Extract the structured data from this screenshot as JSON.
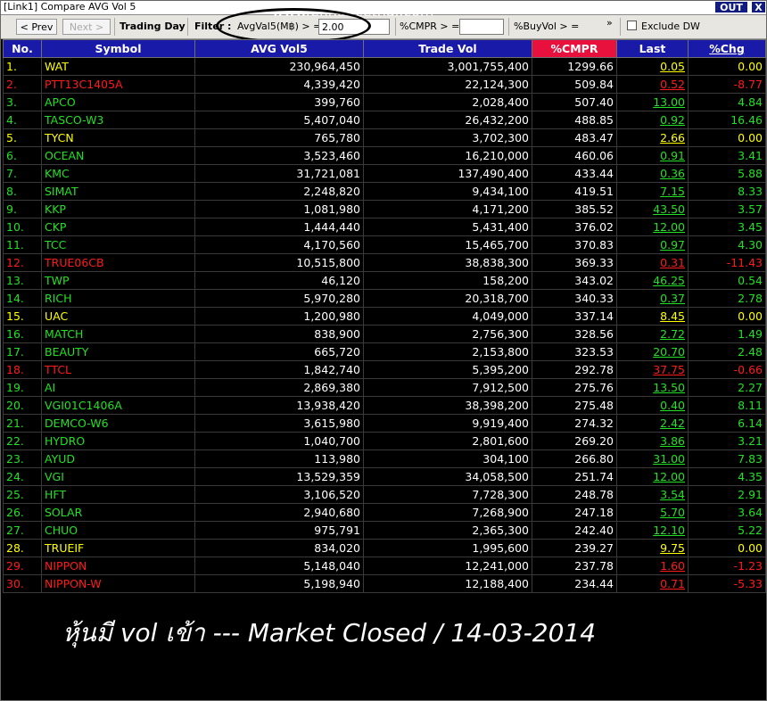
{
  "window": {
    "title": "[Link1] Compare AVG Vol 5",
    "out_label": "OUT",
    "close_label": "X"
  },
  "toolbar": {
    "prev_label": "< Prev",
    "next_label": "Next >",
    "trading_day_label": "Trading Day",
    "filter_label": "Filter :",
    "avgval_label": "AvgVal5(M฿) > =",
    "avgval_value": "2.00",
    "cmpr_label": "%CMPR > =",
    "cmpr_value": "",
    "buyvol_label": "%BuyVol > =",
    "more_label": "»",
    "exclude_dw_label": "Exclude DW",
    "exclude_dw_checked": false
  },
  "watermark": "www.efinancethai.com",
  "table": {
    "headers": {
      "no": "No.",
      "symbol": "Symbol",
      "avg_vol": "AVG Vol5",
      "trade_vol": "Trade Vol",
      "cmpr": "%CMPR",
      "last": "Last",
      "chg": "%Chg"
    },
    "rows": [
      {
        "no": "1.",
        "symbol": "WAT",
        "avg": "230,964,450",
        "trade": "3,001,755,400",
        "cmpr": "1299.66",
        "last": "0.05",
        "chg": "0.00",
        "color": "yellow"
      },
      {
        "no": "2.",
        "symbol": "PTT13C1405A",
        "avg": "4,339,420",
        "trade": "22,124,300",
        "cmpr": "509.84",
        "last": "0.52",
        "chg": "-8.77",
        "color": "red"
      },
      {
        "no": "3.",
        "symbol": "APCO",
        "avg": "399,760",
        "trade": "2,028,400",
        "cmpr": "507.40",
        "last": "13.00",
        "chg": "4.84",
        "color": "green"
      },
      {
        "no": "4.",
        "symbol": "TASCO-W3",
        "avg": "5,407,040",
        "trade": "26,432,200",
        "cmpr": "488.85",
        "last": "0.92",
        "chg": "16.46",
        "color": "green"
      },
      {
        "no": "5.",
        "symbol": "TYCN",
        "avg": "765,780",
        "trade": "3,702,300",
        "cmpr": "483.47",
        "last": "2.66",
        "chg": "0.00",
        "color": "yellow"
      },
      {
        "no": "6.",
        "symbol": "OCEAN",
        "avg": "3,523,460",
        "trade": "16,210,000",
        "cmpr": "460.06",
        "last": "0.91",
        "chg": "3.41",
        "color": "green"
      },
      {
        "no": "7.",
        "symbol": "KMC",
        "avg": "31,721,081",
        "trade": "137,490,400",
        "cmpr": "433.44",
        "last": "0.36",
        "chg": "5.88",
        "color": "green"
      },
      {
        "no": "8.",
        "symbol": "SIMAT",
        "avg": "2,248,820",
        "trade": "9,434,100",
        "cmpr": "419.51",
        "last": "7.15",
        "chg": "8.33",
        "color": "green"
      },
      {
        "no": "9.",
        "symbol": "KKP",
        "avg": "1,081,980",
        "trade": "4,171,200",
        "cmpr": "385.52",
        "last": "43.50",
        "chg": "3.57",
        "color": "green"
      },
      {
        "no": "10.",
        "symbol": "CKP",
        "avg": "1,444,440",
        "trade": "5,431,400",
        "cmpr": "376.02",
        "last": "12.00",
        "chg": "3.45",
        "color": "green"
      },
      {
        "no": "11.",
        "symbol": "TCC",
        "avg": "4,170,560",
        "trade": "15,465,700",
        "cmpr": "370.83",
        "last": "0.97",
        "chg": "4.30",
        "color": "green"
      },
      {
        "no": "12.",
        "symbol": "TRUE06CB",
        "avg": "10,515,800",
        "trade": "38,838,300",
        "cmpr": "369.33",
        "last": "0.31",
        "chg": "-11.43",
        "color": "red"
      },
      {
        "no": "13.",
        "symbol": "TWP",
        "avg": "46,120",
        "trade": "158,200",
        "cmpr": "343.02",
        "last": "46.25",
        "chg": "0.54",
        "color": "green"
      },
      {
        "no": "14.",
        "symbol": "RICH",
        "avg": "5,970,280",
        "trade": "20,318,700",
        "cmpr": "340.33",
        "last": "0.37",
        "chg": "2.78",
        "color": "green"
      },
      {
        "no": "15.",
        "symbol": "UAC",
        "avg": "1,200,980",
        "trade": "4,049,000",
        "cmpr": "337.14",
        "last": "8.45",
        "chg": "0.00",
        "color": "yellow"
      },
      {
        "no": "16.",
        "symbol": "MATCH",
        "avg": "838,900",
        "trade": "2,756,300",
        "cmpr": "328.56",
        "last": "2.72",
        "chg": "1.49",
        "color": "green"
      },
      {
        "no": "17.",
        "symbol": "BEAUTY",
        "avg": "665,720",
        "trade": "2,153,800",
        "cmpr": "323.53",
        "last": "20.70",
        "chg": "2.48",
        "color": "green"
      },
      {
        "no": "18.",
        "symbol": "TTCL",
        "avg": "1,842,740",
        "trade": "5,395,200",
        "cmpr": "292.78",
        "last": "37.75",
        "chg": "-0.66",
        "color": "red"
      },
      {
        "no": "19.",
        "symbol": "AI",
        "avg": "2,869,380",
        "trade": "7,912,500",
        "cmpr": "275.76",
        "last": "13.50",
        "chg": "2.27",
        "color": "green"
      },
      {
        "no": "20.",
        "symbol": "VGI01C1406A",
        "avg": "13,938,420",
        "trade": "38,398,200",
        "cmpr": "275.48",
        "last": "0.40",
        "chg": "8.11",
        "color": "green"
      },
      {
        "no": "21.",
        "symbol": "DEMCO-W6",
        "avg": "3,615,980",
        "trade": "9,919,400",
        "cmpr": "274.32",
        "last": "2.42",
        "chg": "6.14",
        "color": "green"
      },
      {
        "no": "22.",
        "symbol": "HYDRO",
        "avg": "1,040,700",
        "trade": "2,801,600",
        "cmpr": "269.20",
        "last": "3.86",
        "chg": "3.21",
        "color": "green"
      },
      {
        "no": "23.",
        "symbol": "AYUD",
        "avg": "113,980",
        "trade": "304,100",
        "cmpr": "266.80",
        "last": "31.00",
        "chg": "7.83",
        "color": "green"
      },
      {
        "no": "24.",
        "symbol": "VGI",
        "avg": "13,529,359",
        "trade": "34,058,500",
        "cmpr": "251.74",
        "last": "12.00",
        "chg": "4.35",
        "color": "green"
      },
      {
        "no": "25.",
        "symbol": "HFT",
        "avg": "3,106,520",
        "trade": "7,728,300",
        "cmpr": "248.78",
        "last": "3.54",
        "chg": "2.91",
        "color": "green"
      },
      {
        "no": "26.",
        "symbol": "SOLAR",
        "avg": "2,940,680",
        "trade": "7,268,900",
        "cmpr": "247.18",
        "last": "5.70",
        "chg": "3.64",
        "color": "green"
      },
      {
        "no": "27.",
        "symbol": "CHUO",
        "avg": "975,791",
        "trade": "2,365,300",
        "cmpr": "242.40",
        "last": "12.10",
        "chg": "5.22",
        "color": "green"
      },
      {
        "no": "28.",
        "symbol": "TRUEIF",
        "avg": "834,020",
        "trade": "1,995,600",
        "cmpr": "239.27",
        "last": "9.75",
        "chg": "0.00",
        "color": "yellow"
      },
      {
        "no": "29.",
        "symbol": "NIPPON",
        "avg": "5,148,040",
        "trade": "12,241,000",
        "cmpr": "237.78",
        "last": "1.60",
        "chg": "-1.23",
        "color": "red"
      },
      {
        "no": "30.",
        "symbol": "NIPPON-W",
        "avg": "5,198,940",
        "trade": "12,188,400",
        "cmpr": "234.44",
        "last": "0.71",
        "chg": "-5.33",
        "color": "red"
      }
    ]
  },
  "caption": "หุ้นมี vol เข้า  --- Market Closed  / 14-03-2014",
  "colors": {
    "header_bg": "#1a1aa8",
    "cmpr_header_bg": "#e8103c",
    "yellow": "#ffff00",
    "red": "#ff1a1a",
    "green": "#22e022"
  }
}
